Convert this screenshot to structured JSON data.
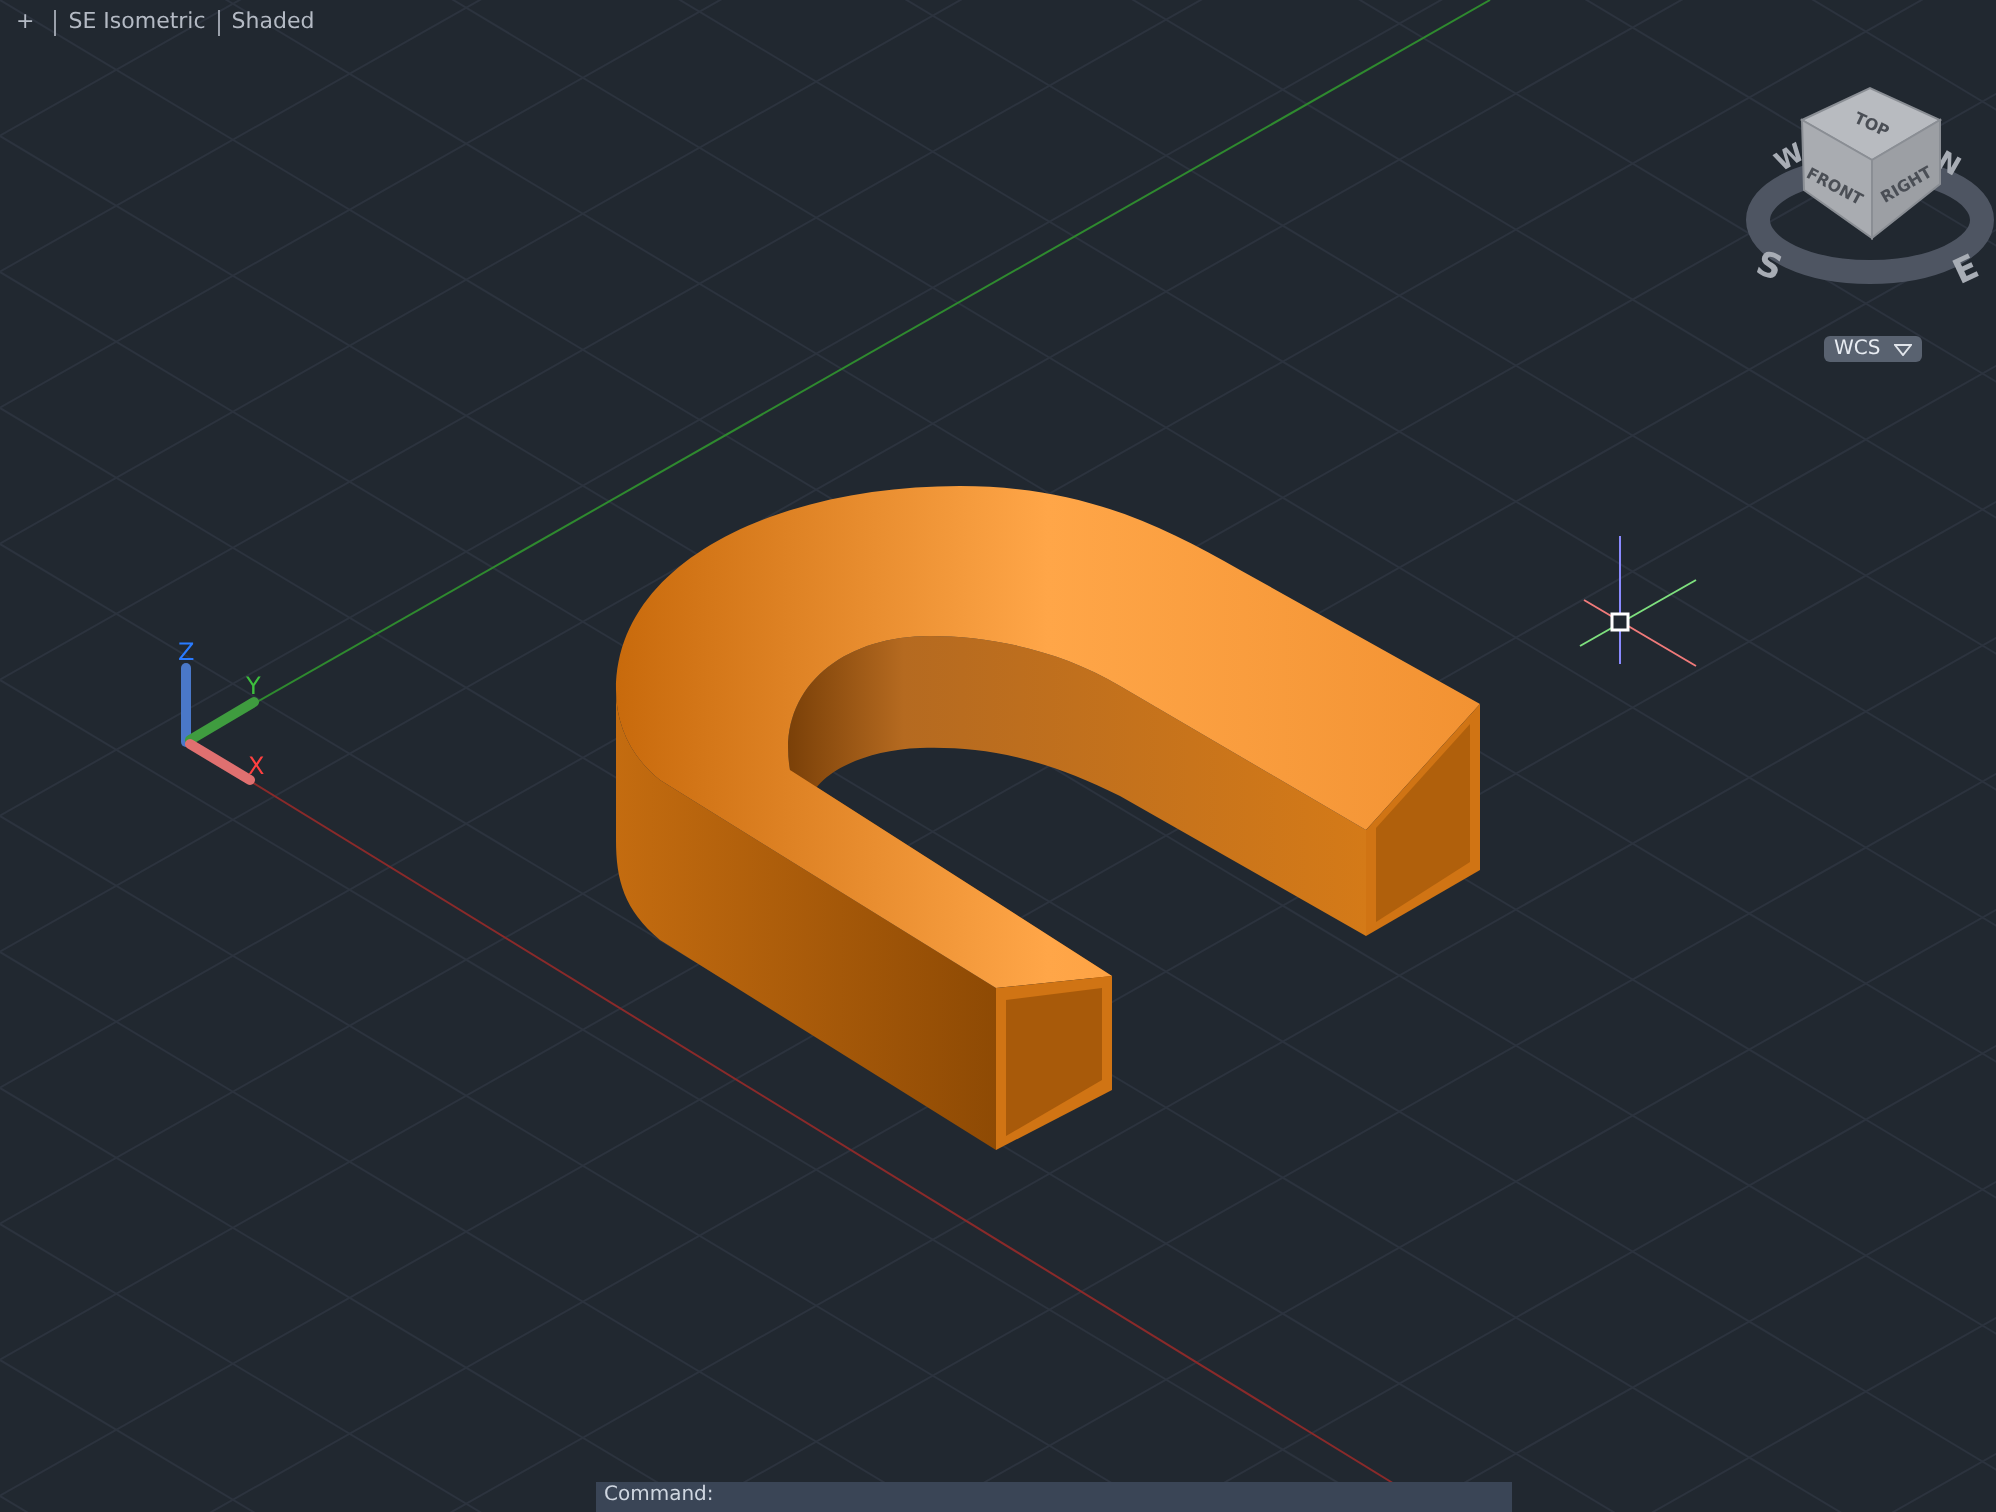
{
  "viewport_controls": [
    {
      "label": "+"
    },
    {
      "label": "SE Isometric"
    },
    {
      "label": "Shaded"
    }
  ],
  "viewcube": {
    "top": "TOP",
    "front": "FRONT",
    "right": "RIGHT",
    "compass": {
      "north": "N",
      "east": "E",
      "south": "S",
      "west": "W"
    }
  },
  "coordinate_system": {
    "label": "WCS"
  },
  "ucs_icon": {
    "x": "X",
    "y": "Y",
    "z": "Z"
  },
  "command_line": {
    "prompt": "Command:"
  }
}
